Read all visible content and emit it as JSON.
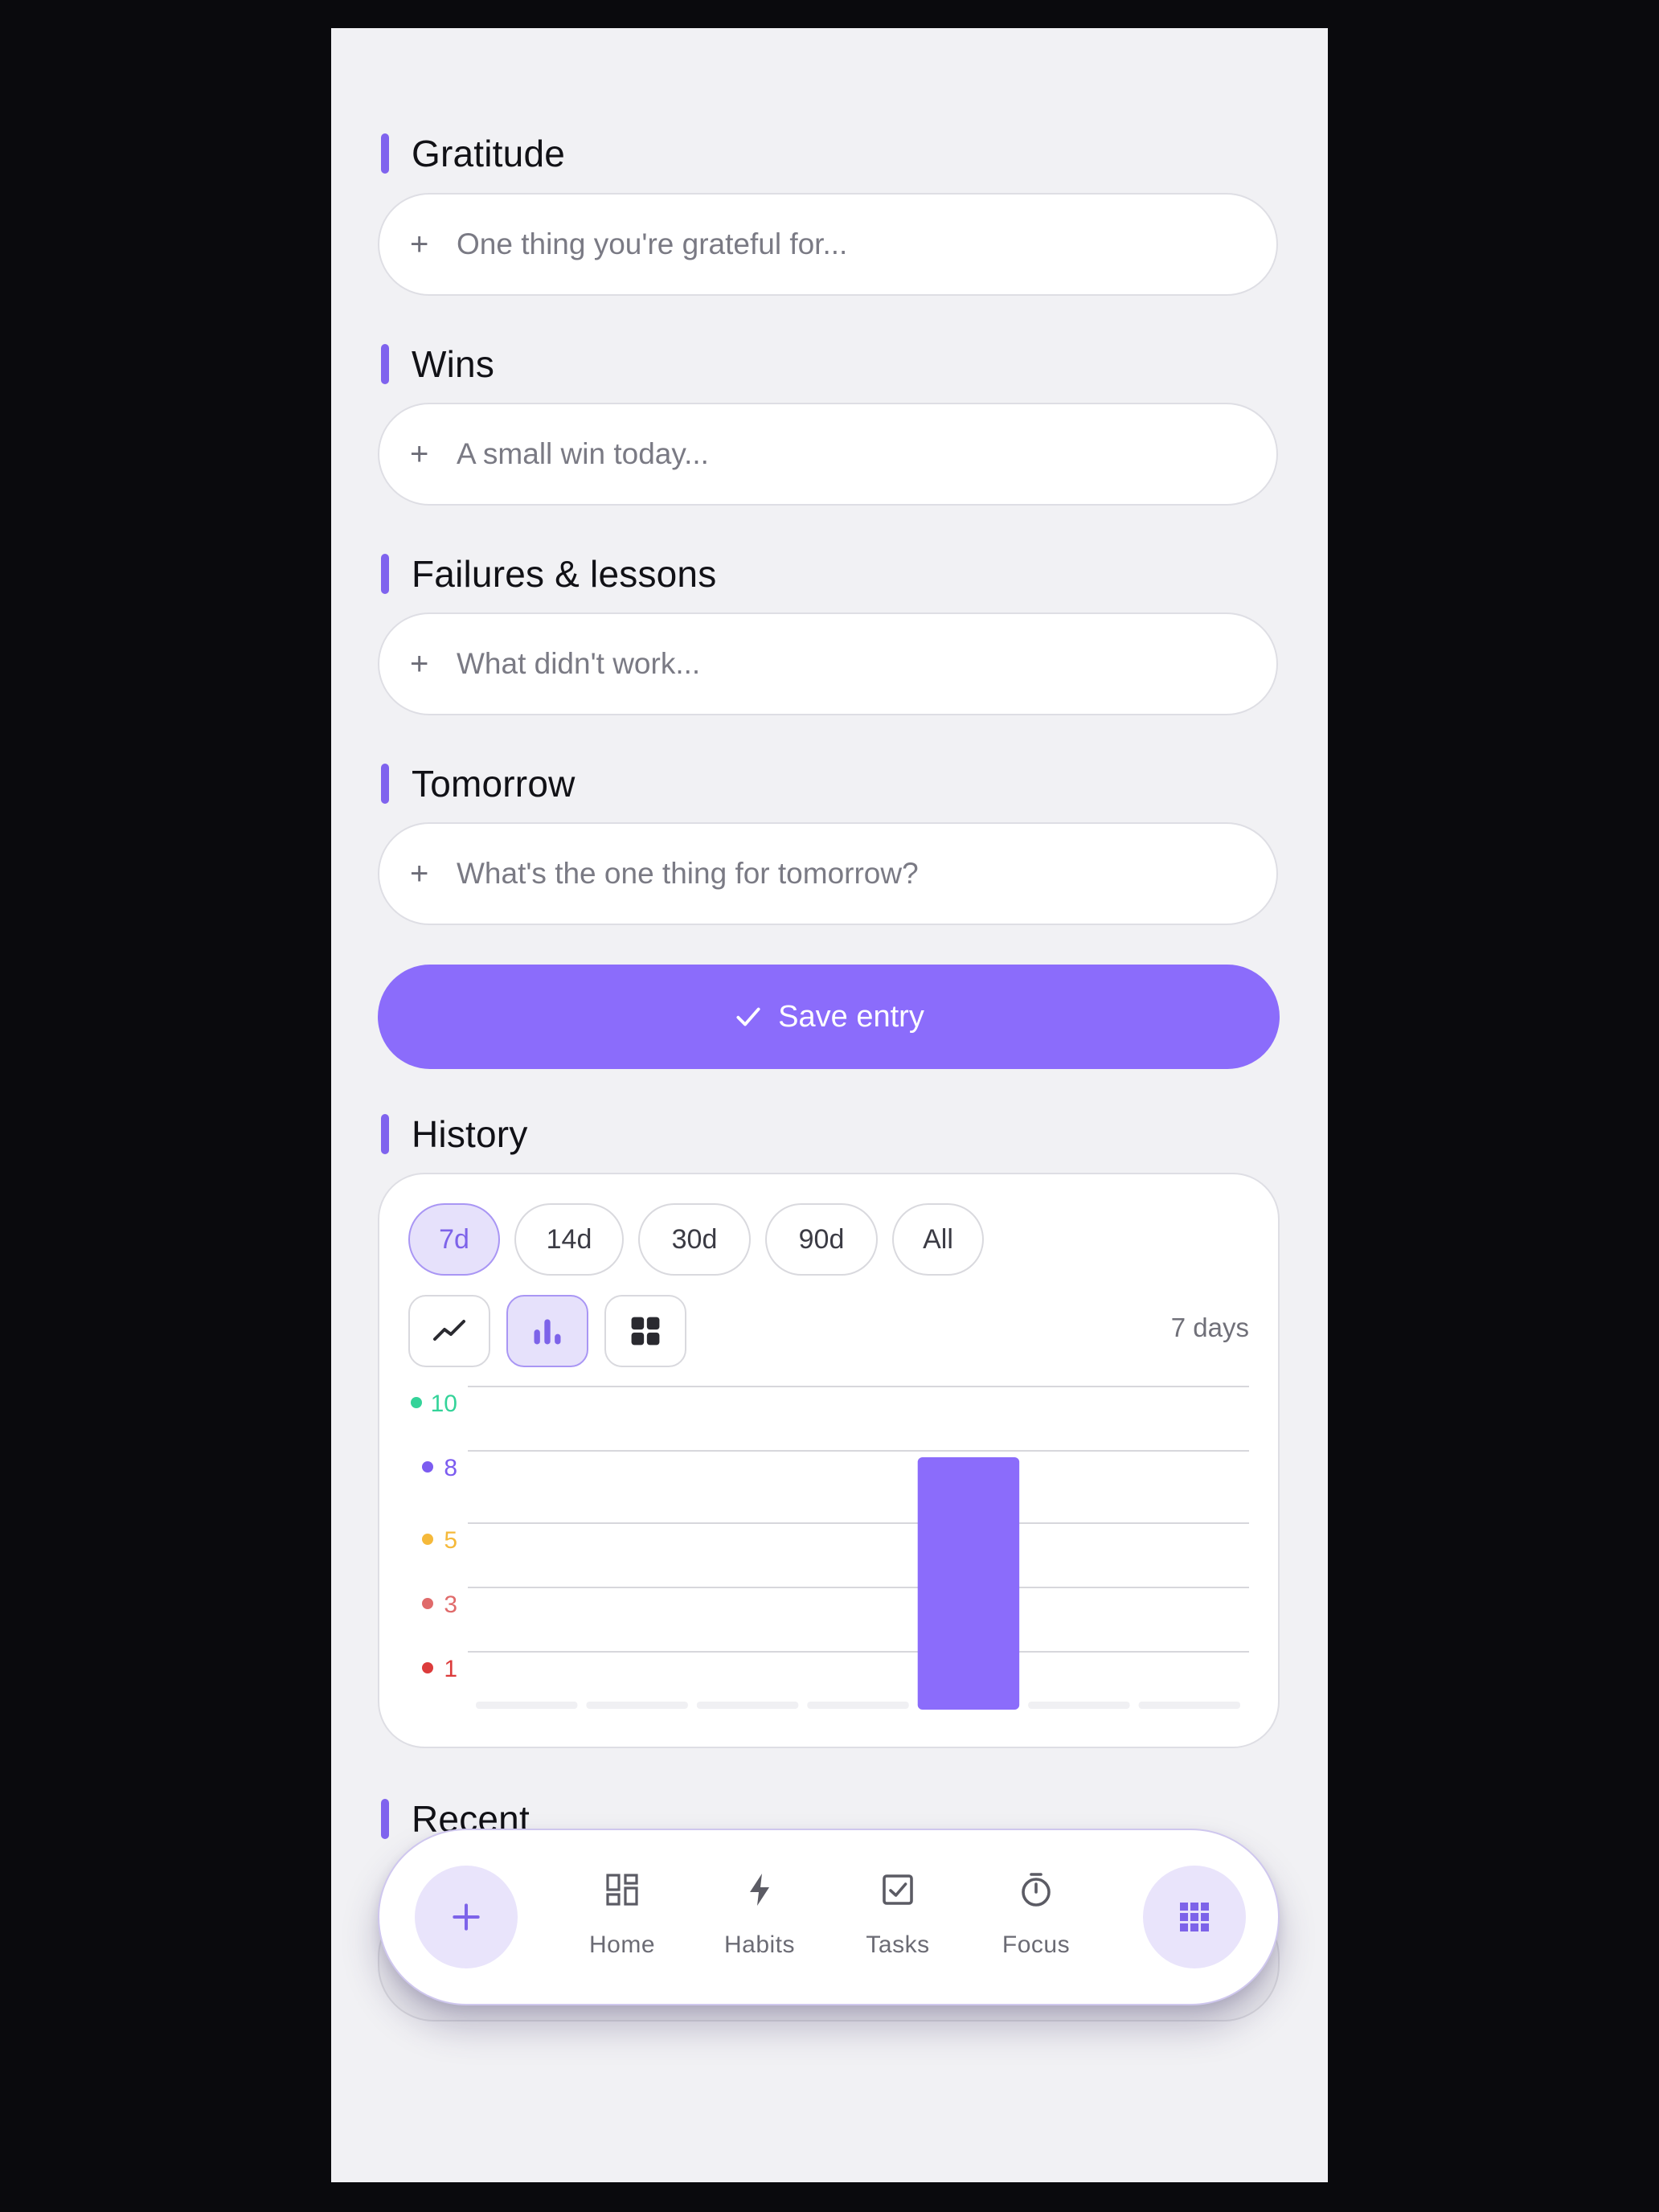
{
  "sections": {
    "gratitude": {
      "title": "Gratitude",
      "placeholder": "One thing you're grateful for..."
    },
    "wins": {
      "title": "Wins",
      "placeholder": "A small win today..."
    },
    "failures": {
      "title": "Failures & lessons",
      "placeholder": "What didn't work..."
    },
    "tomorrow": {
      "title": "Tomorrow",
      "placeholder": "What's the one thing for tomorrow?"
    }
  },
  "plus_glyph": "+",
  "save_label": "Save entry",
  "history": {
    "title": "History",
    "ranges": [
      "7d",
      "14d",
      "30d",
      "90d",
      "All"
    ],
    "active_range": "7d",
    "views": [
      "line-chart-icon",
      "bar-chart-icon",
      "grid-icon"
    ],
    "active_view": "bar-chart-icon",
    "days_label": "7 days"
  },
  "chart_data": {
    "type": "bar",
    "categories": [
      "day-1",
      "day-2",
      "day-3",
      "day-4",
      "day-5",
      "day-6",
      "day-7"
    ],
    "values": [
      null,
      null,
      null,
      null,
      8,
      null,
      null
    ],
    "y_ticks": [
      {
        "value": 10,
        "label": "10",
        "color": "#34d399"
      },
      {
        "value": 8,
        "label": "8",
        "color": "#7c5cf0"
      },
      {
        "value": 5,
        "label": "5",
        "color": "#f5b93a"
      },
      {
        "value": 3,
        "label": "3",
        "color": "#e06a6a"
      },
      {
        "value": 1,
        "label": "1",
        "color": "#dc3b3b"
      }
    ],
    "bar_color": "#8b6cfb",
    "grid": true
  },
  "recent": {
    "title": "Recent"
  },
  "dock": {
    "items": [
      {
        "label": "Home",
        "icon": "home-icon"
      },
      {
        "label": "Habits",
        "icon": "bolt-icon"
      },
      {
        "label": "Tasks",
        "icon": "checkbox-icon"
      },
      {
        "label": "Focus",
        "icon": "timer-icon"
      }
    ],
    "fab_icon": "plus-icon",
    "apps_icon": "apps-grid-icon"
  },
  "colors": {
    "accent": "#8b6cfb",
    "accent_soft": "#e6e1fb",
    "background": "#f1f1f4"
  }
}
